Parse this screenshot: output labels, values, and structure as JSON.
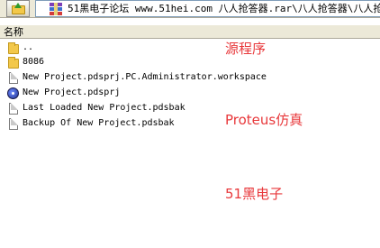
{
  "toolbar": {
    "up_button_icon": "up-folder-icon",
    "archive_icon": "winrar-archive-icon",
    "path": "51黑电子论坛 www.51hei.com 八人抢答器.rar\\八人抢答器\\八人抢"
  },
  "columns": {
    "name": "名称"
  },
  "files": [
    {
      "name": "..",
      "icon": "folder-icon"
    },
    {
      "name": "8086",
      "icon": "folder-icon"
    },
    {
      "name": "New Project.pdsprj.PC.Administrator.workspace",
      "icon": "document-icon"
    },
    {
      "name": "New Project.pdsprj",
      "icon": "proteus-project-icon"
    },
    {
      "name": "Last Loaded New Project.pdsbak",
      "icon": "document-icon"
    },
    {
      "name": "Backup Of New Project.pdsbak",
      "icon": "document-icon"
    }
  ],
  "annotations": {
    "source_code": "源程序",
    "proteus_sim": "Proteus仿真",
    "brand": "51黑电子"
  },
  "colors": {
    "annotation": "#e8383b",
    "toolbar_bg": "#ece9d8"
  }
}
